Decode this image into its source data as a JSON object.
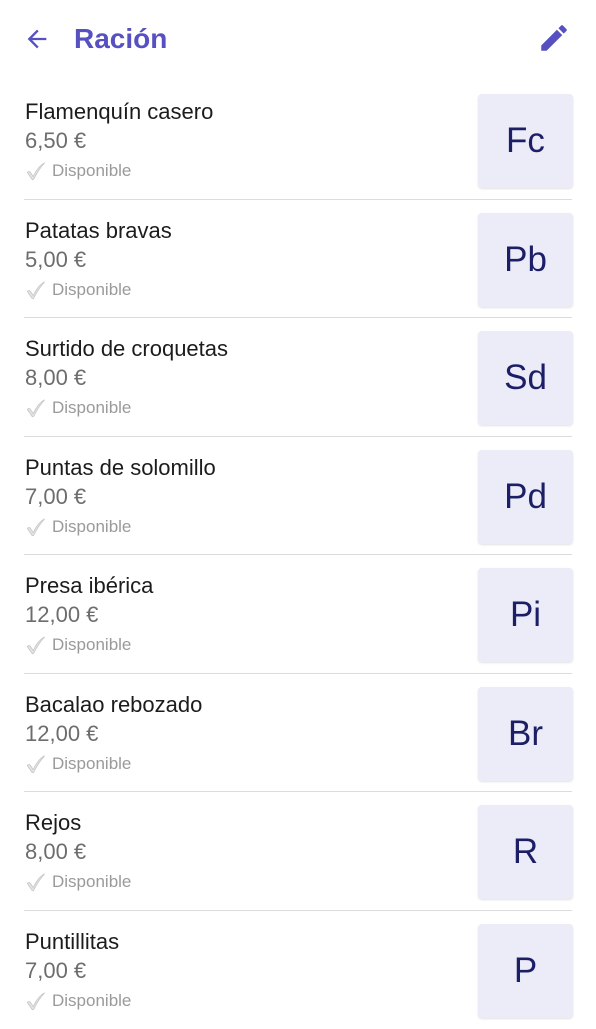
{
  "header": {
    "title": "Ración",
    "back_icon": "arrow-left-icon",
    "edit_icon": "pencil-icon",
    "accent_color": "#5650c0"
  },
  "items": [
    {
      "name": "Flamenquín casero",
      "price": "6,50 €",
      "status": "Disponible",
      "initials": "Fc"
    },
    {
      "name": "Patatas bravas",
      "price": "5,00 €",
      "status": "Disponible",
      "initials": "Pb"
    },
    {
      "name": "Surtido de croquetas",
      "price": "8,00 €",
      "status": "Disponible",
      "initials": "Sd"
    },
    {
      "name": "Puntas de solomillo",
      "price": "7,00 €",
      "status": "Disponible",
      "initials": "Pd"
    },
    {
      "name": "Presa ibérica",
      "price": "12,00 €",
      "status": "Disponible",
      "initials": "Pi"
    },
    {
      "name": "Bacalao rebozado",
      "price": "12,00 €",
      "status": "Disponible",
      "initials": "Br"
    },
    {
      "name": "Rejos",
      "price": "8,00 €",
      "status": "Disponible",
      "initials": "R"
    },
    {
      "name": "Puntillitas",
      "price": "7,00 €",
      "status": "Disponible",
      "initials": "P"
    }
  ]
}
